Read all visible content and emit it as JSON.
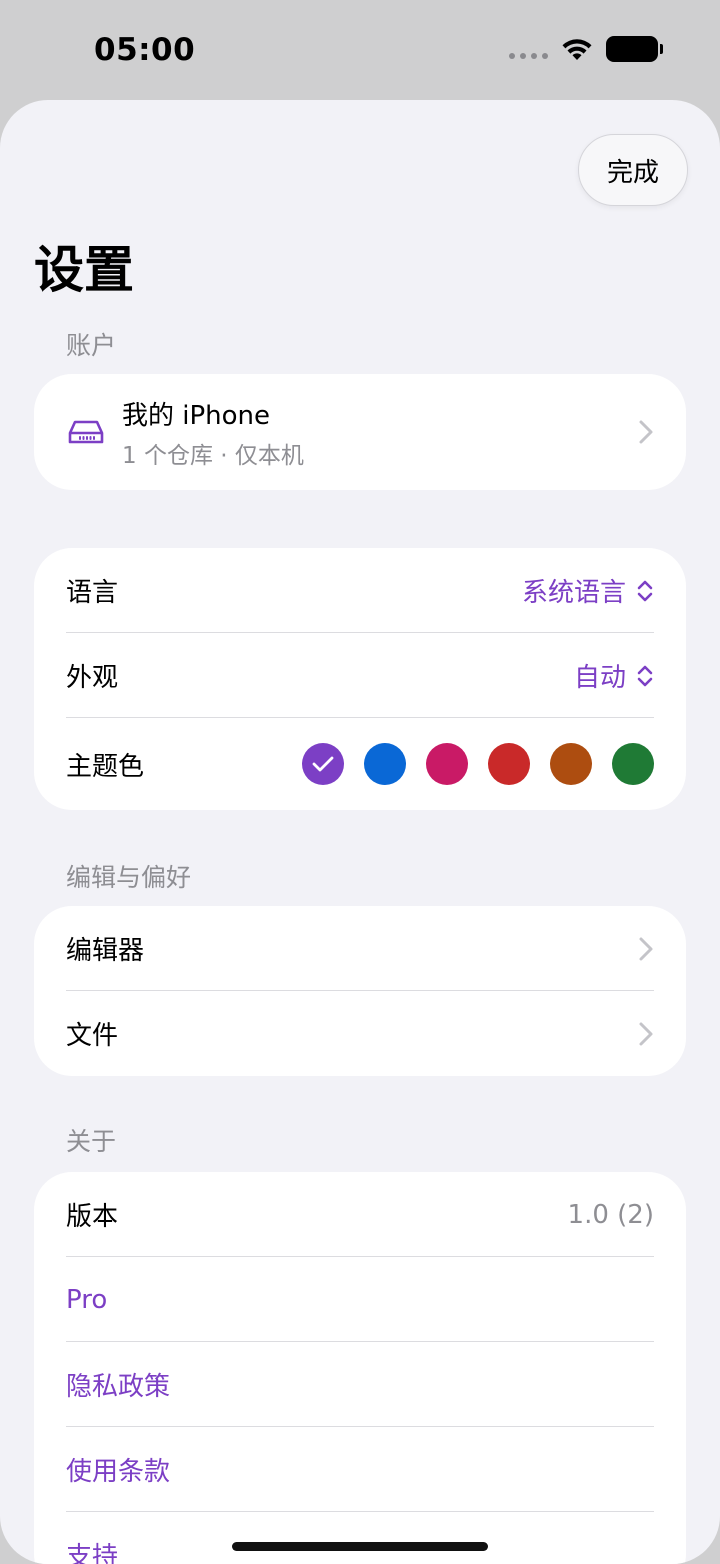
{
  "status": {
    "time": "05:00"
  },
  "header": {
    "done_label": "完成",
    "title": "设置"
  },
  "account": {
    "section_title": "账户",
    "device_name": "我的 iPhone",
    "device_sub": "1 个仓库 · 仅本机",
    "icon": "drive-icon"
  },
  "general": {
    "language_label": "语言",
    "language_value": "系统语言",
    "appearance_label": "外观",
    "appearance_value": "自动",
    "theme_label": "主题色",
    "theme_colors": [
      "#7c3fc5",
      "#0a68d6",
      "#c91a66",
      "#c92929",
      "#ad4d10",
      "#1f7a35"
    ],
    "theme_selected": 0
  },
  "editing": {
    "section_title": "编辑与偏好",
    "editor_label": "编辑器",
    "files_label": "文件"
  },
  "about": {
    "section_title": "关于",
    "version_label": "版本",
    "version_value": "1.0 (2)",
    "pro_label": "Pro",
    "privacy_label": "隐私政策",
    "terms_label": "使用条款",
    "support_label": "支持"
  },
  "colors": {
    "accent": "#7c3fc5",
    "secondary_text": "#8e8e93",
    "background": "#f2f2f7"
  }
}
